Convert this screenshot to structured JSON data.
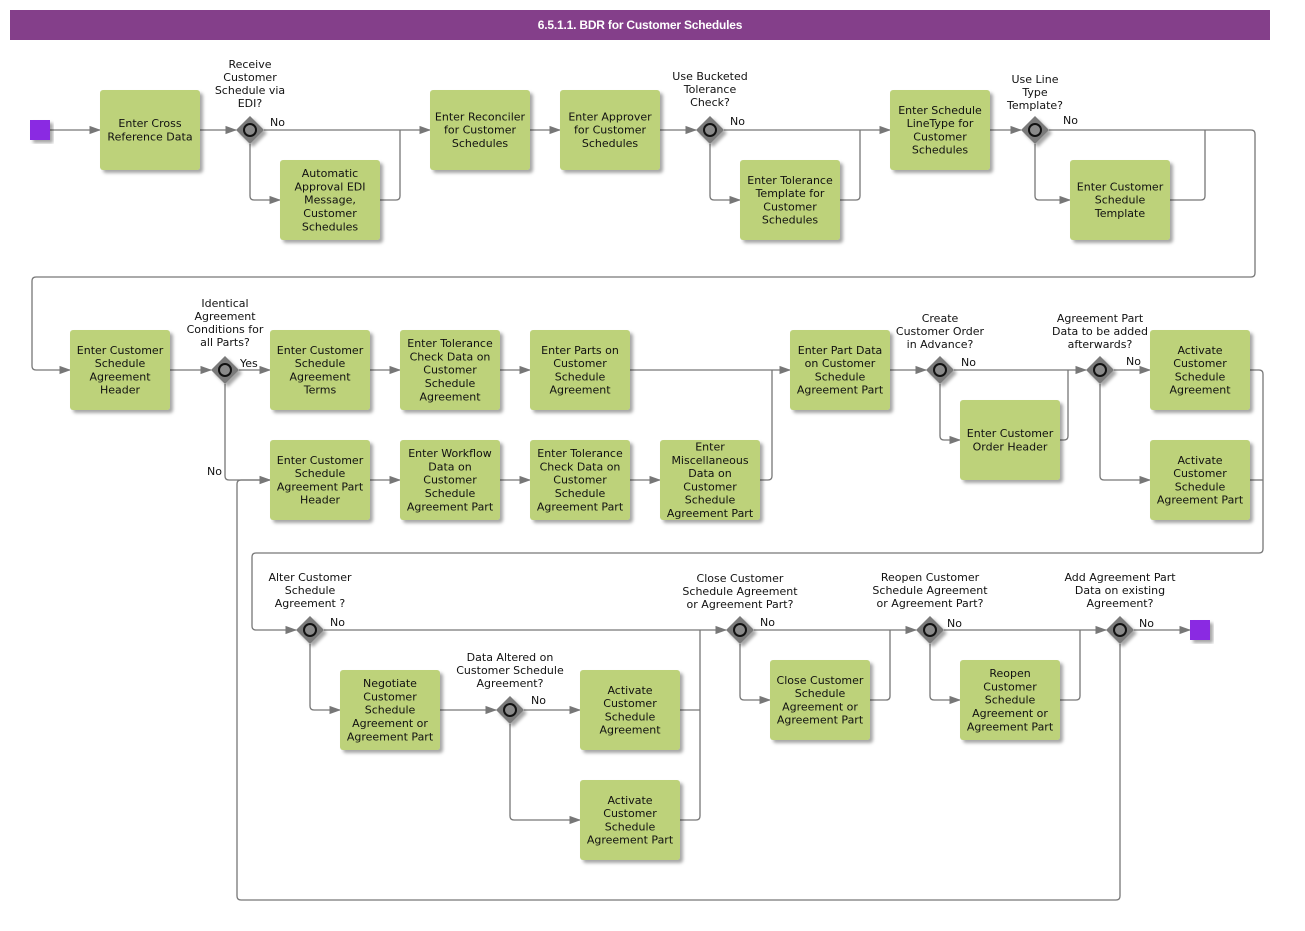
{
  "title": "6.5.1.1. BDR for Customer Schedules",
  "colors": {
    "title_bar": "#843f8a",
    "task_fill": "#bdd27a",
    "event_fill": "#8a2be2",
    "gateway_fill": "#7a7a7a",
    "flow_line": "#777777"
  },
  "events": [
    {
      "id": "start",
      "kind": "start"
    },
    {
      "id": "end",
      "kind": "end"
    }
  ],
  "tasks": [
    {
      "id": "t1",
      "lines": [
        "Enter Cross",
        "Reference Data"
      ]
    },
    {
      "id": "t2",
      "lines": [
        "Automatic",
        "Approval EDI",
        "Message,",
        "Customer",
        "Schedules"
      ]
    },
    {
      "id": "t3",
      "lines": [
        "Enter Reconciler",
        "for Customer",
        "Schedules"
      ]
    },
    {
      "id": "t4",
      "lines": [
        "Enter Approver",
        "for Customer",
        "Schedules"
      ]
    },
    {
      "id": "t5",
      "lines": [
        "Enter Tolerance",
        "Template for",
        "Customer",
        "Schedules"
      ]
    },
    {
      "id": "t6",
      "lines": [
        "Enter Schedule",
        "LineType for",
        "Customer",
        "Schedules"
      ]
    },
    {
      "id": "t7",
      "lines": [
        "Enter Customer",
        "Schedule",
        "Template"
      ]
    },
    {
      "id": "t8",
      "lines": [
        "Enter Customer",
        "Schedule",
        "Agreement",
        "Header"
      ]
    },
    {
      "id": "t9",
      "lines": [
        "Enter Customer",
        "Schedule",
        "Agreement",
        "Terms"
      ]
    },
    {
      "id": "t10",
      "lines": [
        "Enter Tolerance",
        "Check Data on",
        "Customer",
        "Schedule",
        "Agreement"
      ]
    },
    {
      "id": "t11",
      "lines": [
        "Enter Parts on",
        "Customer",
        "Schedule",
        "Agreement"
      ]
    },
    {
      "id": "t12",
      "lines": [
        "Enter Customer",
        "Schedule",
        "Agreement Part",
        "Header"
      ]
    },
    {
      "id": "t13",
      "lines": [
        "Enter Workflow",
        "Data on",
        "Customer",
        "Schedule",
        "Agreement Part"
      ]
    },
    {
      "id": "t14",
      "lines": [
        "Enter Tolerance",
        "Check Data on",
        "Customer",
        "Schedule",
        "Agreement Part"
      ]
    },
    {
      "id": "t15",
      "lines": [
        "Enter",
        "Miscellaneous",
        "Data on",
        "Customer",
        "Schedule",
        "Agreement Part"
      ]
    },
    {
      "id": "t16",
      "lines": [
        "Enter Part Data",
        "on Customer",
        "Schedule",
        "Agreement Part"
      ]
    },
    {
      "id": "t17",
      "lines": [
        "Enter Customer",
        "Order Header"
      ]
    },
    {
      "id": "t18",
      "lines": [
        "Activate",
        "Customer",
        "Schedule",
        "Agreement"
      ]
    },
    {
      "id": "t19",
      "lines": [
        "Activate",
        "Customer",
        "Schedule",
        "Agreement Part"
      ]
    },
    {
      "id": "t20",
      "lines": [
        "Negotiate",
        "Customer",
        "Schedule",
        "Agreement or",
        "Agreement Part"
      ]
    },
    {
      "id": "t21",
      "lines": [
        "Activate",
        "Customer",
        "Schedule",
        "Agreement"
      ]
    },
    {
      "id": "t22",
      "lines": [
        "Activate",
        "Customer",
        "Schedule",
        "Agreement Part"
      ]
    },
    {
      "id": "t23",
      "lines": [
        "Close Customer",
        "Schedule",
        "Agreement or",
        "Agreement Part"
      ]
    },
    {
      "id": "t24",
      "lines": [
        "Reopen",
        "Customer",
        "Schedule",
        "Agreement or",
        "Agreement Part"
      ]
    }
  ],
  "gateways": [
    {
      "id": "g1",
      "question": [
        "Receive",
        "Customer",
        "Schedule via",
        "EDI?"
      ],
      "branch_label": "No"
    },
    {
      "id": "g2",
      "question": [
        "Use Bucketed",
        "Tolerance",
        "Check?"
      ],
      "branch_label": "No"
    },
    {
      "id": "g3",
      "question": [
        "Use Line",
        "Type",
        "Template?"
      ],
      "branch_label": "No"
    },
    {
      "id": "g4",
      "question": [
        "Identical",
        "Agreement",
        "Conditions for",
        "all Parts?"
      ],
      "branch_label": "Yes",
      "alt_label": "No"
    },
    {
      "id": "g5",
      "question": [
        "Create",
        "Customer Order",
        "in Advance?"
      ],
      "branch_label": "No"
    },
    {
      "id": "g6",
      "question": [
        "Agreement Part",
        "Data to be added",
        "afterwards?"
      ],
      "branch_label": "No"
    },
    {
      "id": "g7",
      "question": [
        "Alter Customer",
        "Schedule",
        "Agreement ?"
      ],
      "branch_label": "No"
    },
    {
      "id": "g8",
      "question": [
        "Data Altered on",
        "Customer Schedule",
        "Agreement?"
      ],
      "branch_label": "No"
    },
    {
      "id": "g9",
      "question": [
        "Close Customer",
        "Schedule Agreement",
        "or Agreement Part?"
      ],
      "branch_label": "No"
    },
    {
      "id": "g10",
      "question": [
        "Reopen Customer",
        "Schedule Agreement",
        "or Agreement Part?"
      ],
      "branch_label": "No"
    },
    {
      "id": "g11",
      "question": [
        "Add Agreement Part",
        "Data on existing",
        "Agreement?"
      ],
      "branch_label": "No"
    }
  ]
}
